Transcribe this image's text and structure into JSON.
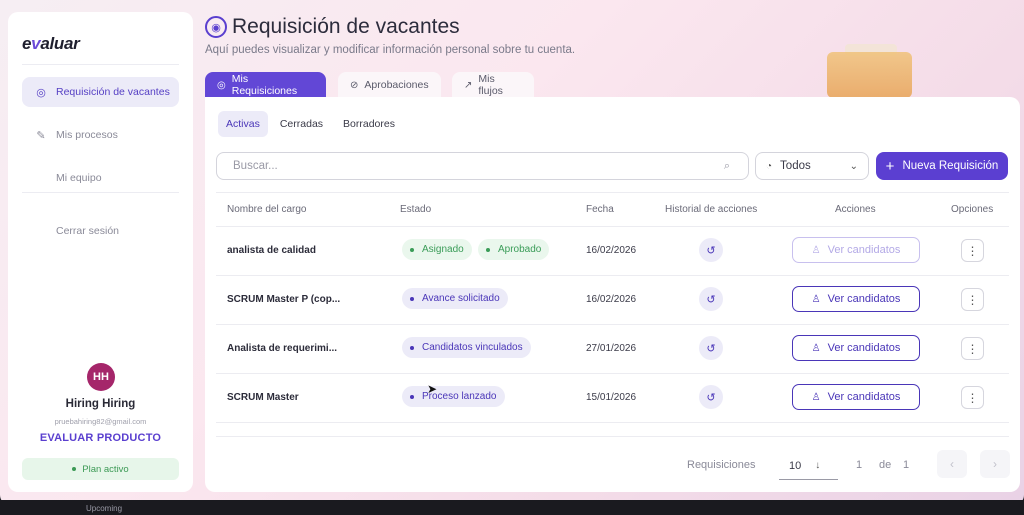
{
  "sidebar": {
    "logo_prefix": "e",
    "logo_accent": "v",
    "logo_suffix": "aluar",
    "items": [
      {
        "label": "Requisición de vacantes",
        "icon": "target-icon"
      },
      {
        "label": "Mis procesos",
        "icon": "edit-icon"
      },
      {
        "label": "Mi equipo",
        "icon": "team-icon"
      },
      {
        "label": "Cerrar sesión",
        "icon": "logout-icon"
      }
    ],
    "user": {
      "initials": "HH",
      "name": "Hiring Hiring",
      "email": "pruebahiring82@gmail.com",
      "company": "EVALUAR PRODUCTO",
      "plan": "Plan activo"
    }
  },
  "header": {
    "title": "Requisición de vacantes",
    "subtitle": "Aquí puedes visualizar y modificar información personal sobre tu cuenta."
  },
  "tabs": [
    {
      "label": "Mis Requisiciones",
      "active": true
    },
    {
      "label": "Aprobaciones",
      "active": false
    },
    {
      "label": "Mis flujos",
      "active": false
    }
  ],
  "sub_tabs": [
    {
      "label": "Activas",
      "active": true
    },
    {
      "label": "Cerradas",
      "active": false
    },
    {
      "label": "Borradores",
      "active": false
    }
  ],
  "search": {
    "placeholder": "Buscar..."
  },
  "filter": {
    "selected": "Todos"
  },
  "new_button": {
    "label": "Nueva Requisición"
  },
  "table": {
    "columns": [
      "Nombre del cargo",
      "Estado",
      "Fecha",
      "Historial de acciones",
      "Acciones",
      "Opciones"
    ],
    "rows": [
      {
        "name": "analista de calidad",
        "badges": [
          {
            "label": "Asignado",
            "color": "green"
          },
          {
            "label": "Aprobado",
            "color": "green"
          }
        ],
        "date": "16/02/2026",
        "action": "Ver candidatos",
        "action_enabled": false
      },
      {
        "name": "SCRUM Master P (cop...",
        "badges": [
          {
            "label": "Avance solicitado",
            "color": "purple"
          }
        ],
        "date": "16/02/2026",
        "action": "Ver candidatos",
        "action_enabled": true
      },
      {
        "name": "Analista de requerimi...",
        "badges": [
          {
            "label": "Candidatos vinculados",
            "color": "purple"
          }
        ],
        "date": "27/01/2026",
        "action": "Ver candidatos",
        "action_enabled": true
      },
      {
        "name": "SCRUM Master",
        "badges": [
          {
            "label": "Proceso lanzado",
            "color": "purple"
          }
        ],
        "date": "15/01/2026",
        "action": "Ver candidatos",
        "action_enabled": true
      }
    ]
  },
  "pagination": {
    "label": "Requisiciones",
    "page_size": "10",
    "current": "1",
    "of": "de",
    "total": "1"
  },
  "footer_text": "Upcoming",
  "colors": {
    "accent": "#5b3fd1",
    "green": "#3a9c58",
    "avatar": "#a5266a"
  }
}
